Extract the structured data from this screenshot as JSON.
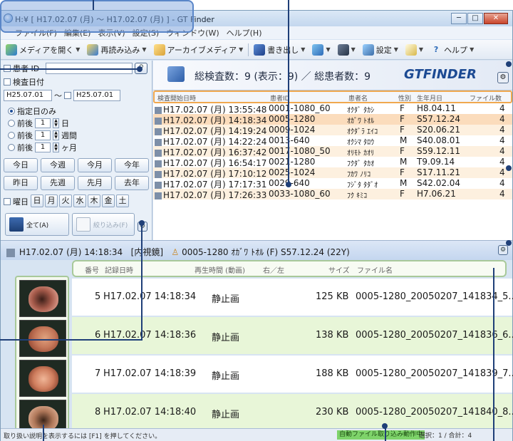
{
  "window": {
    "title": "H:¥ [ H17.02.07 (月) ～ H17.02.07 (月) ] - GT Finder",
    "controls": [
      "minimize",
      "maximize",
      "close"
    ]
  },
  "menu": [
    "ファイル(F)",
    "編集(E)",
    "表示(V)",
    "設定(S)",
    "ウィンドウ(W)",
    "ヘルプ(H)"
  ],
  "toolbar": {
    "open_media": "メディアを開く",
    "reload": "再読み込み",
    "archive_media": "アーカイブメディア",
    "export": "書き出し",
    "settings": "設定",
    "help": "ヘルプ"
  },
  "filter": {
    "patient_id_label": "患者 ID",
    "exam_date_label": "検査日付",
    "date_from": "H25.07.01",
    "date_sep": "～",
    "date_to": "H25.07.01",
    "radio_specified": "指定日のみ",
    "radio_before_after": "前後",
    "spin_value": "1",
    "unit_day": "日",
    "unit_week": "週間",
    "unit_month": "ヶ月",
    "btn_today": "今日",
    "btn_this_week": "今週",
    "btn_this_month": "今月",
    "btn_this_year": "今年",
    "btn_yesterday": "昨日",
    "btn_last_week": "先週",
    "btn_last_month": "先月",
    "btn_last_year": "去年",
    "weekday_label": "曜日",
    "weekdays": [
      "日",
      "月",
      "火",
      "水",
      "木",
      "金",
      "土"
    ],
    "btn_all": "全て(A)",
    "btn_narrow": "絞り込み(F)"
  },
  "summary": {
    "text": "総検査数：9 (表示：9) ／ 総患者数：9",
    "brand": "GTFINDER"
  },
  "exam_table": {
    "headers": [
      "検査開始日時",
      "患者ID",
      "患者名",
      "性別",
      "生年月日",
      "ファイル数"
    ],
    "rows": [
      {
        "datetime": "H17.02.07 (月) 13:55:48",
        "id": "0001-1080_60",
        "name": "ｵｸﾀﾞ ﾀｶｼ",
        "sex": "F",
        "birth": "H8.04.11",
        "files": "4"
      },
      {
        "datetime": "H17.02.07 (月) 14:18:34",
        "id": "0005-1280",
        "name": "ｵｶﾞﾜ ﾄｵﾙ",
        "sex": "F",
        "birth": "S57.12.24",
        "files": "4"
      },
      {
        "datetime": "H17.02.07 (月) 14:19:24",
        "id": "0009-1024",
        "name": "ｵｸﾀﾞﾗ ｴｲｺ",
        "sex": "F",
        "birth": "S20.06.21",
        "files": "4"
      },
      {
        "datetime": "H17.02.07 (月) 14:22:24",
        "id": "0013-640",
        "name": "ｵｸｼﾏ ﾀﾛｳ",
        "sex": "M",
        "birth": "S40.08.01",
        "files": "4"
      },
      {
        "datetime": "H17.02.07 (月) 16:37:42",
        "id": "0017-1080_50",
        "name": "ｵﾘﾓﾄ ｶｵﾘ",
        "sex": "F",
        "birth": "S59.12.11",
        "files": "4"
      },
      {
        "datetime": "H17.02.07 (月) 16:54:17",
        "id": "0021-1280",
        "name": "ﾌｸﾀﾞ ﾀｶｵ",
        "sex": "M",
        "birth": "T9.09.14",
        "files": "4"
      },
      {
        "datetime": "H17.02.07 (月) 17:10:12",
        "id": "0025-1024",
        "name": "ﾌｶﾜ ﾉﾘｺ",
        "sex": "F",
        "birth": "S17.11.21",
        "files": "4"
      },
      {
        "datetime": "H17.02.07 (月) 17:17:31",
        "id": "0029-640",
        "name": "ﾌｼﾞﾀ ﾀﾀﾞｵ",
        "sex": "M",
        "birth": "S42.02.04",
        "files": "4"
      },
      {
        "datetime": "H17.02.07 (月) 17:26:33",
        "id": "0033-1080_60",
        "name": "ﾌｸ ｷﾐｺ",
        "sex": "F",
        "birth": "H7.06.21",
        "files": "4"
      }
    ]
  },
  "detail": {
    "header_date": "H17.02.07 (月) 14:18:34",
    "header_type": "[内視鏡]",
    "header_patient": "0005-1280 ｵｶﾞﾜ ﾄｵﾙ (F) S57.12.24 (22Y)",
    "columns": [
      "番号",
      "記録日時",
      "再生時間 (動画)",
      "右／左",
      "サイズ",
      "ファイル名"
    ],
    "records": [
      {
        "no": "5",
        "time": "H17.02.07 14:18:34",
        "type": "静止画",
        "size": "125 KB",
        "file": "0005-1280_20050207_141834_5..."
      },
      {
        "no": "6",
        "time": "H17.02.07 14:18:36",
        "type": "静止画",
        "size": "138 KB",
        "file": "0005-1280_20050207_141836_6..."
      },
      {
        "no": "7",
        "time": "H17.02.07 14:18:39",
        "type": "静止画",
        "size": "188 KB",
        "file": "0005-1280_20050207_141839_7..."
      },
      {
        "no": "8",
        "time": "H17.02.07 14:18:40",
        "type": "静止画",
        "size": "230 KB",
        "file": "0005-1280_20050207_141840_8..."
      }
    ]
  },
  "status": {
    "help_text": "取り扱い説明を表示するには [F1] を押してください。",
    "auto_import": "自動ファイル取り込み動作中",
    "selection": "選択：1 / 合計：4"
  },
  "colors": {
    "accent_orange": "#f0a84f",
    "accent_green": "#a8c99a",
    "row_orange": "#fdf0df",
    "row_green": "#e8f6d8",
    "brand_blue": "#1c4a93"
  }
}
